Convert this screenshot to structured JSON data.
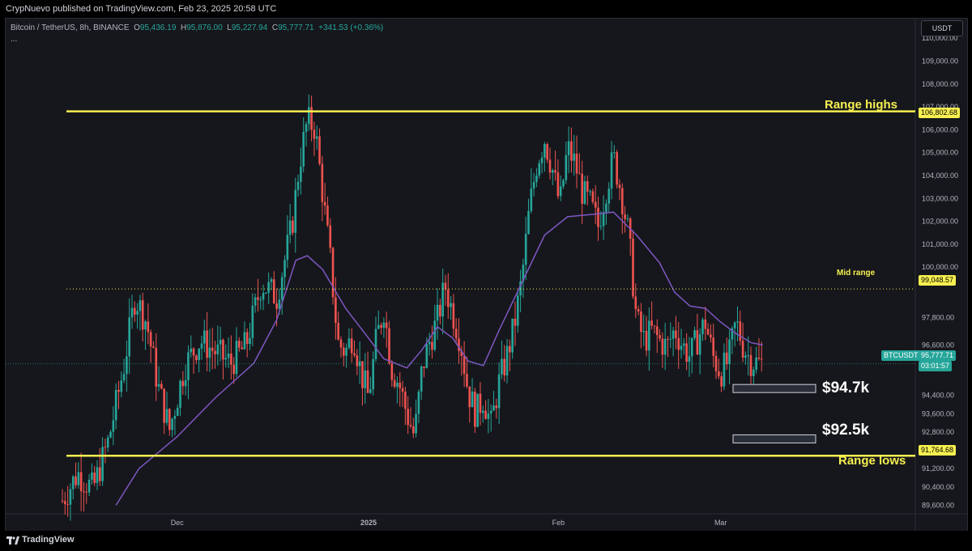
{
  "header": {
    "publisher_line": "CrypNuevo published on TradingView.com, Feb 23, 2025 20:58 UTC"
  },
  "legend": {
    "symbol": "Bitcoin / TetherUS, 8h, BINANCE",
    "open_label": "O",
    "open": "95,436.19",
    "high_label": "H",
    "high": "95,876.00",
    "low_label": "L",
    "low": "95,227.94",
    "close_label": "C",
    "close": "95,777.71",
    "change": "+341.53 (+0.36%)",
    "more": "..."
  },
  "toolbar": {
    "currency": "USDT"
  },
  "price_axis": {
    "ticks": [
      "110,000.00",
      "109,000.00",
      "108,000.00",
      "107,000.00",
      "106,000.00",
      "105,000.00",
      "104,000.00",
      "103,000.00",
      "102,000.00",
      "101,000.00",
      "100,000.00",
      "97,800.00",
      "96,600.00",
      "94,400.00",
      "93,600.00",
      "92,800.00",
      "91,200.00",
      "90,400.00",
      "89,600.00"
    ]
  },
  "time_axis": {
    "labels": [
      {
        "text": "Dec",
        "bold": false
      },
      {
        "text": "2025",
        "bold": true
      },
      {
        "text": "Feb",
        "bold": false
      },
      {
        "text": "Mar",
        "bold": false
      }
    ]
  },
  "levels": {
    "range_high": {
      "label": "Range highs",
      "price": "106,802.68"
    },
    "mid_range": {
      "label": "Mid range",
      "price": "99,048.57"
    },
    "range_low": {
      "label": "Range lows",
      "price": "91,764.68"
    }
  },
  "current": {
    "symbol": "BTCUSDT",
    "price": "95,777.71",
    "countdown": "03:01:57"
  },
  "targets": [
    {
      "label": "$94.7k"
    },
    {
      "label": "$92.5k"
    }
  ],
  "colors": {
    "background": "#16171c",
    "bull": "#26a69a",
    "bear": "#ef5350",
    "level": "#f7f050",
    "ma": "#7e57c2"
  },
  "footer": {
    "brand": "TradingView",
    "logo_icon": "tradingview-logo-icon"
  },
  "chart_data": {
    "type": "candlestick",
    "title": "Bitcoin / TetherUS, 8h, BINANCE",
    "xlabel": "",
    "ylabel": "",
    "ylim": [
      89300,
      110500
    ],
    "x_ticks": [
      "Dec",
      "2025",
      "Feb",
      "Mar"
    ],
    "horizontal_levels": [
      {
        "name": "Range highs",
        "value": 106802.68,
        "style": "solid"
      },
      {
        "name": "Mid range",
        "value": 99048.57,
        "style": "dotted"
      },
      {
        "name": "Range lows",
        "value": 91764.68,
        "style": "solid"
      }
    ],
    "target_boxes": [
      {
        "label": "$94.7k",
        "value": 94700
      },
      {
        "label": "$92.5k",
        "value": 92500
      }
    ],
    "last_close": 95777.71,
    "moving_average": {
      "points": [
        [
          0.07,
          89600
        ],
        [
          0.1,
          91200
        ],
        [
          0.15,
          92600
        ],
        [
          0.2,
          94300
        ],
        [
          0.25,
          95800
        ],
        [
          0.28,
          97700
        ],
        [
          0.305,
          100300
        ],
        [
          0.32,
          100500
        ],
        [
          0.34,
          99900
        ],
        [
          0.37,
          98200
        ],
        [
          0.4,
          96900
        ],
        [
          0.42,
          96000
        ],
        [
          0.45,
          95600
        ],
        [
          0.47,
          96400
        ],
        [
          0.49,
          97400
        ],
        [
          0.51,
          96900
        ],
        [
          0.53,
          95900
        ],
        [
          0.55,
          95700
        ],
        [
          0.57,
          97200
        ],
        [
          0.6,
          99300
        ],
        [
          0.63,
          101400
        ],
        [
          0.66,
          102200
        ],
        [
          0.69,
          102300
        ],
        [
          0.72,
          102400
        ],
        [
          0.75,
          101400
        ],
        [
          0.78,
          100200
        ],
        [
          0.8,
          98900
        ],
        [
          0.82,
          98300
        ],
        [
          0.84,
          98200
        ],
        [
          0.86,
          97600
        ],
        [
          0.88,
          97100
        ],
        [
          0.9,
          96700
        ],
        [
          0.915,
          96600
        ]
      ]
    },
    "candles_path": {
      "points": [
        [
          0.0,
          89800
        ],
        [
          0.02,
          91000
        ],
        [
          0.04,
          90300
        ],
        [
          0.06,
          92400
        ],
        [
          0.08,
          95600
        ],
        [
          0.095,
          98700
        ],
        [
          0.11,
          97600
        ],
        [
          0.125,
          94800
        ],
        [
          0.14,
          92900
        ],
        [
          0.16,
          95700
        ],
        [
          0.18,
          96800
        ],
        [
          0.2,
          96300
        ],
        [
          0.22,
          95800
        ],
        [
          0.24,
          96600
        ],
        [
          0.26,
          99300
        ],
        [
          0.28,
          98700
        ],
        [
          0.3,
          101800
        ],
        [
          0.31,
          104600
        ],
        [
          0.32,
          106400
        ],
        [
          0.33,
          106100
        ],
        [
          0.34,
          103200
        ],
        [
          0.35,
          100300
        ],
        [
          0.36,
          96700
        ],
        [
          0.37,
          96300
        ],
        [
          0.38,
          97100
        ],
        [
          0.39,
          95400
        ],
        [
          0.4,
          94300
        ],
        [
          0.41,
          96800
        ],
        [
          0.42,
          98200
        ],
        [
          0.43,
          95600
        ],
        [
          0.44,
          94900
        ],
        [
          0.45,
          93600
        ],
        [
          0.46,
          92600
        ],
        [
          0.47,
          95600
        ],
        [
          0.48,
          96800
        ],
        [
          0.49,
          97700
        ],
        [
          0.5,
          99200
        ],
        [
          0.51,
          98000
        ],
        [
          0.52,
          96800
        ],
        [
          0.53,
          94600
        ],
        [
          0.54,
          93600
        ],
        [
          0.55,
          94300
        ],
        [
          0.56,
          93100
        ],
        [
          0.57,
          94900
        ],
        [
          0.58,
          96000
        ],
        [
          0.59,
          97400
        ],
        [
          0.6,
          99400
        ],
        [
          0.61,
          102500
        ],
        [
          0.62,
          104600
        ],
        [
          0.63,
          105600
        ],
        [
          0.64,
          104300
        ],
        [
          0.65,
          102700
        ],
        [
          0.66,
          105200
        ],
        [
          0.67,
          104500
        ],
        [
          0.68,
          103200
        ],
        [
          0.69,
          102700
        ],
        [
          0.7,
          101800
        ],
        [
          0.71,
          103400
        ],
        [
          0.72,
          104800
        ],
        [
          0.73,
          103300
        ],
        [
          0.74,
          101300
        ],
        [
          0.75,
          97700
        ],
        [
          0.76,
          96800
        ],
        [
          0.77,
          97200
        ],
        [
          0.78,
          96800
        ],
        [
          0.79,
          96500
        ],
        [
          0.8,
          97300
        ],
        [
          0.81,
          96600
        ],
        [
          0.82,
          96100
        ],
        [
          0.83,
          96900
        ],
        [
          0.84,
          97600
        ],
        [
          0.85,
          96100
        ],
        [
          0.86,
          95400
        ],
        [
          0.87,
          95900
        ],
        [
          0.88,
          97600
        ],
        [
          0.89,
          96500
        ],
        [
          0.9,
          95900
        ],
        [
          0.91,
          95800
        ]
      ]
    },
    "last_bar_x": 0.914
  }
}
